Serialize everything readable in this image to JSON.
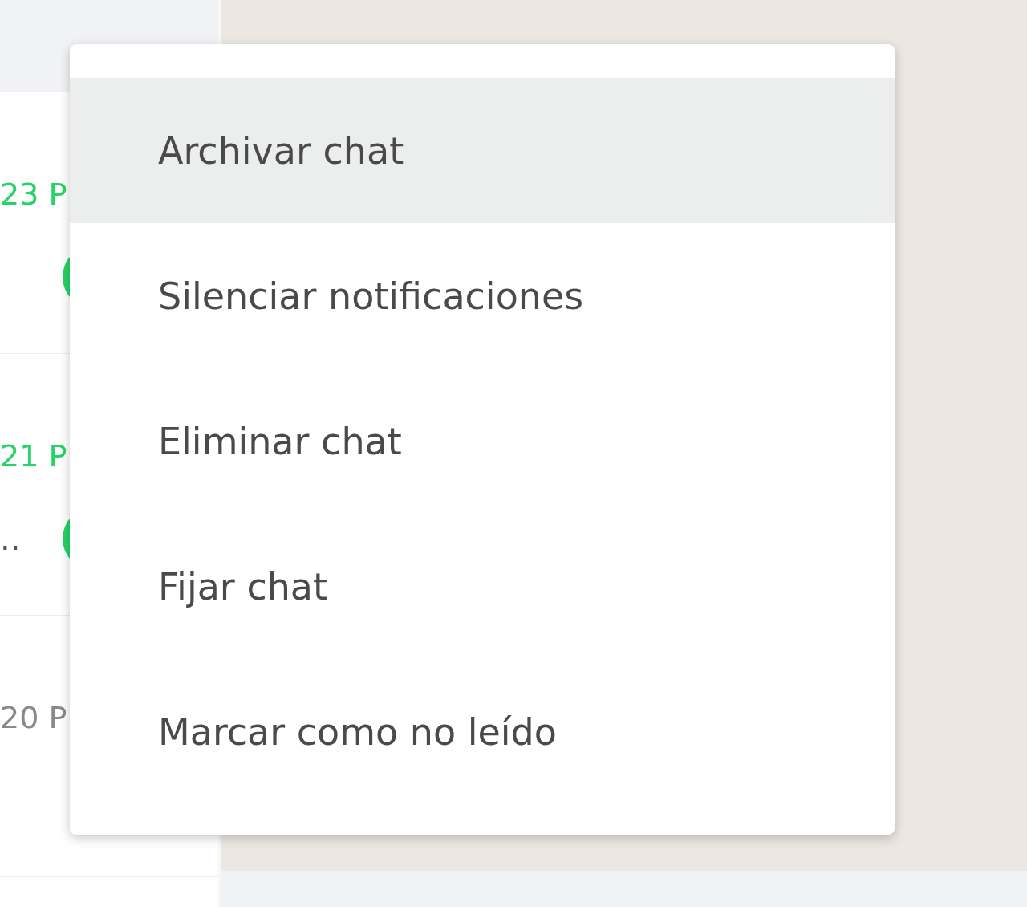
{
  "chats": [
    {
      "time": "23 P",
      "unread": true
    },
    {
      "time": "21 P",
      "preview": "..",
      "unread": true
    },
    {
      "time": "20 P",
      "unread": false
    }
  ],
  "menu": {
    "items": [
      {
        "label": "Archivar chat",
        "selected": true
      },
      {
        "label": "Silenciar notificaciones",
        "selected": false
      },
      {
        "label": "Eliminar chat",
        "selected": false
      },
      {
        "label": "Fijar chat",
        "selected": false
      },
      {
        "label": "Marcar como no leído",
        "selected": false
      }
    ]
  }
}
